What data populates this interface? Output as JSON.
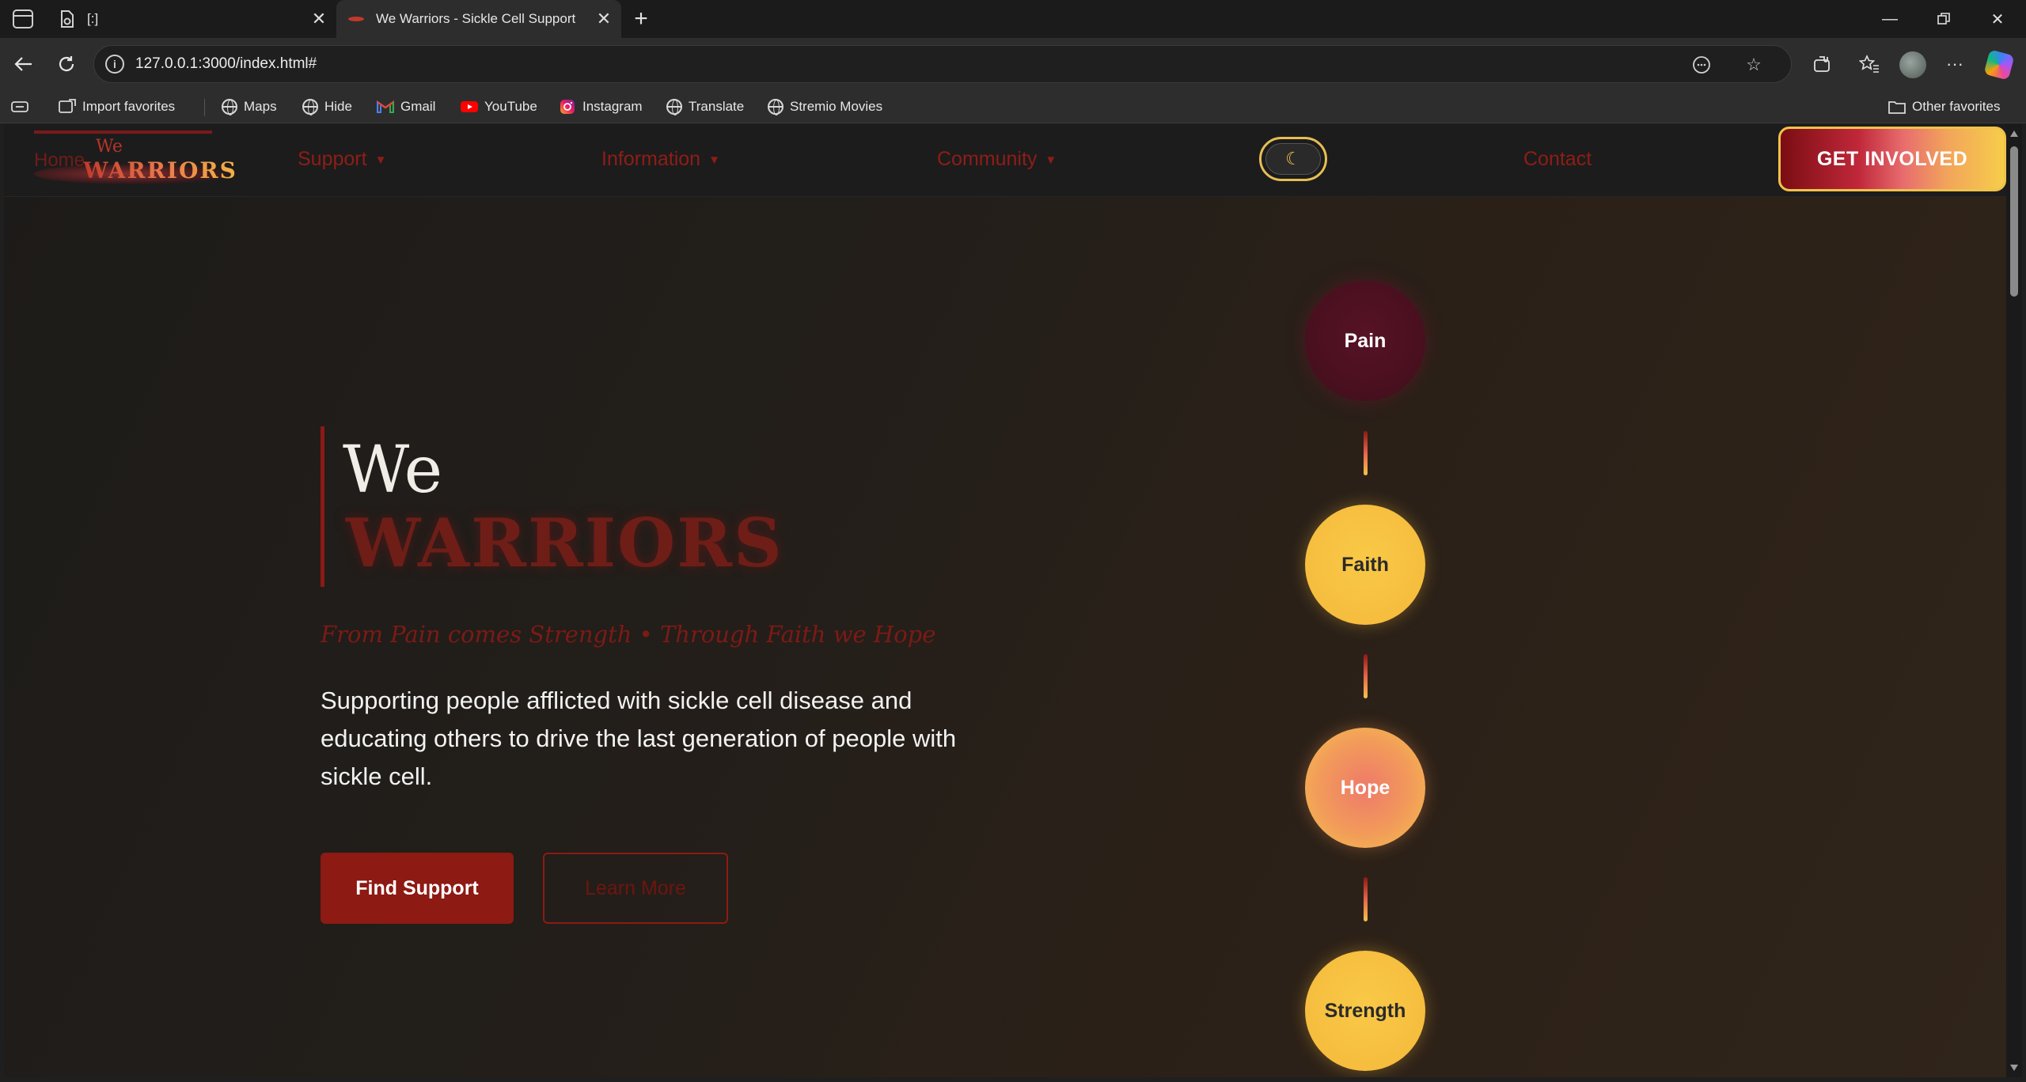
{
  "browser": {
    "tabs": [
      {
        "title": "[:]",
        "active": false
      },
      {
        "title": "We Warriors - Sickle Cell Support",
        "active": true
      }
    ],
    "url": "127.0.0.1:3000/index.html#",
    "bookmarks": [
      {
        "label": "Import favorites",
        "icon": "import-icon"
      },
      {
        "label": "Maps",
        "icon": "globe-icon"
      },
      {
        "label": "Hide",
        "icon": "globe-icon"
      },
      {
        "label": "Gmail",
        "icon": "gmail-icon"
      },
      {
        "label": "YouTube",
        "icon": "youtube-icon"
      },
      {
        "label": "Instagram",
        "icon": "instagram-icon"
      },
      {
        "label": "Translate",
        "icon": "globe-icon"
      },
      {
        "label": "Stremio Movies",
        "icon": "globe-icon"
      }
    ],
    "other_favorites": "Other favorites"
  },
  "site": {
    "logo": {
      "home": "Home",
      "we": "We",
      "warriors": "WARRIORS"
    },
    "nav": {
      "support": "Support",
      "information": "Information",
      "community": "Community",
      "contact": "Contact",
      "theme_icon": "moon-icon",
      "cta": "GET INVOLVED"
    },
    "hero": {
      "title_we": "We",
      "title_warriors": "WARRIORS",
      "tagline": "From Pain comes Strength • Through Faith we Hope",
      "description": "Supporting people afflicted with sickle cell disease and educating others to drive the last generation of people with sickle cell.",
      "primary_button": "Find Support",
      "secondary_button": "Learn More"
    },
    "journey": [
      "Pain",
      "Faith",
      "Hope",
      "Strength"
    ]
  },
  "colors": {
    "accent_red": "#8d1a13",
    "accent_gold": "#f5b83a",
    "pain": "#4a1020",
    "background": "#1d1b19"
  }
}
